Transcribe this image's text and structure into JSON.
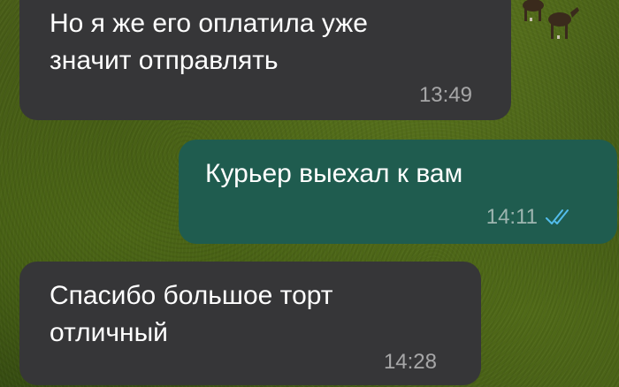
{
  "messages": [
    {
      "direction": "incoming",
      "lines": [
        "Но я же его оплатила уже",
        "значит отправлять"
      ],
      "time": "13:49"
    },
    {
      "direction": "outgoing",
      "lines": [
        "Курьер выехал к вам"
      ],
      "time": "14:11",
      "status": "read-double-check-icon"
    },
    {
      "direction": "incoming",
      "lines": [
        "Спасибо большое торт",
        "отличный"
      ],
      "time": "14:28"
    }
  ],
  "colors": {
    "incoming_bubble": "#363638",
    "outgoing_bubble": "#1f5c4f",
    "read_ticks": "#53bdeb",
    "wallpaper": "#3c5212"
  }
}
